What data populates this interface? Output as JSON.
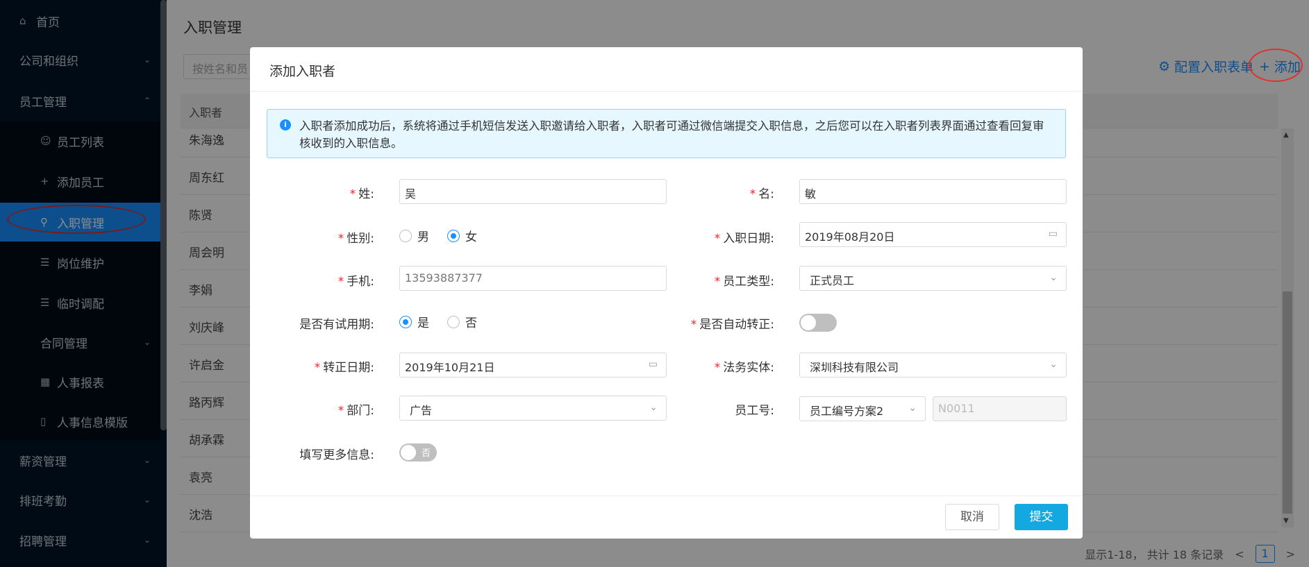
{
  "sidebar": {
    "items": [
      {
        "label": "首页",
        "icon": "home-icon"
      },
      {
        "label": "公司和组织",
        "icon": "chevron-down-icon"
      },
      {
        "label": "员工管理",
        "icon": "chevron-up-icon"
      },
      {
        "label": "员工列表",
        "icon": "users-icon"
      },
      {
        "label": "添加员工",
        "icon": "plus-icon"
      },
      {
        "label": "入职管理",
        "icon": "user-icon"
      },
      {
        "label": "岗位维护",
        "icon": "list-icon"
      },
      {
        "label": "临时调配",
        "icon": "list-icon"
      },
      {
        "label": "合同管理",
        "icon": "chevron-down-icon"
      },
      {
        "label": "人事报表",
        "icon": "table-icon"
      },
      {
        "label": "人事信息模版",
        "icon": "file-icon"
      },
      {
        "label": "薪资管理",
        "icon": "chevron-down-icon"
      },
      {
        "label": "排班考勤",
        "icon": "chevron-down-icon"
      },
      {
        "label": "招聘管理",
        "icon": "chevron-down-icon"
      }
    ]
  },
  "main": {
    "title": "入职管理",
    "search_placeholder": "按姓名和员",
    "config_label": "配置入职表单",
    "add_label": "添加",
    "table_header": "入职者",
    "rows": [
      "朱海逸",
      "周东红",
      "陈贤",
      "周会明",
      "李娟",
      "刘庆峰",
      "许启金",
      "路丙辉",
      "胡承霖",
      "袁亮",
      "沈浩"
    ],
    "pager_text": "显示1-18， 共计 18 条记录",
    "page_num": "1"
  },
  "modal": {
    "title": "添加入职者",
    "notice": "入职者添加成功后，系统将通过手机短信发送入职邀请给入职者，入职者可通过微信端提交入职信息，之后您可以在入职者列表界面通过查看回复审核收到的入职信息。",
    "fields": {
      "surname_label": "姓:",
      "surname_value": "吴",
      "given_label": "名:",
      "given_value": "敏",
      "gender_label": "性别:",
      "gender_male": "男",
      "gender_female": "女",
      "gender_selected": "女",
      "entry_date_label": "入职日期:",
      "entry_date_value": "2019年08月20日",
      "phone_label": "手机:",
      "phone_value": "13593887377",
      "emp_type_label": "员工类型:",
      "emp_type_value": "正式员工",
      "probation_label": "是否有试用期:",
      "probation_yes": "是",
      "probation_no": "否",
      "probation_selected": "是",
      "auto_regular_label": "是否自动转正:",
      "auto_regular_on": false,
      "regular_date_label": "转正日期:",
      "regular_date_value": "2019年10月21日",
      "legal_entity_label": "法务实体:",
      "legal_entity_value": "深圳科技有限公司",
      "dept_label": "部门:",
      "dept_value": "广告",
      "emp_no_label": "员工号:",
      "emp_no_scheme": "员工编号方案2",
      "emp_no_value": "N0011",
      "more_info_label": "填写更多信息:",
      "more_info_switch_text": "否"
    },
    "cancel_label": "取消",
    "submit_label": "提交"
  },
  "colors": {
    "sidebar_bg": "#001529",
    "accent": "#1890ff",
    "submit": "#13a8e0",
    "required": "#f5222d",
    "annotation_circle": "#e03131"
  }
}
